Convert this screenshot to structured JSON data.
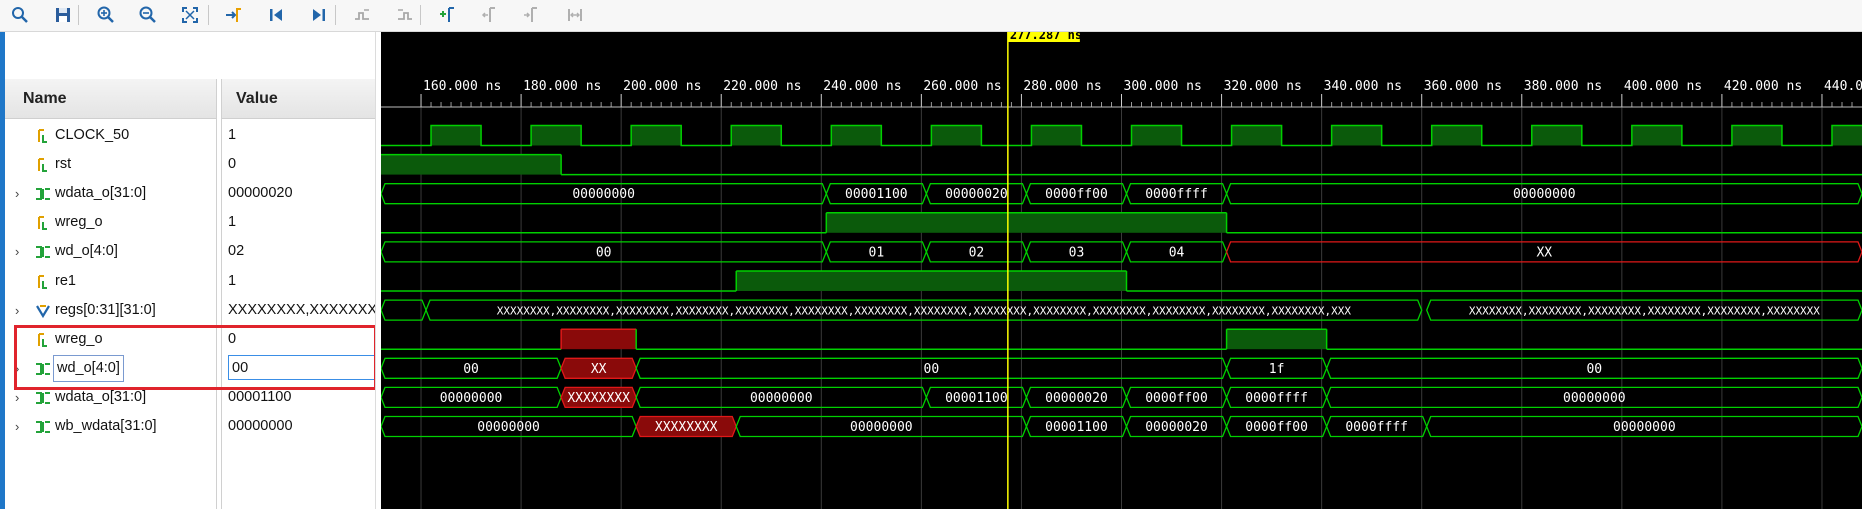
{
  "toolbar": {
    "buttons": [
      {
        "name": "search-icon"
      },
      {
        "name": "save-icon"
      },
      {
        "name": "zoom-in-icon"
      },
      {
        "name": "zoom-out-icon"
      },
      {
        "name": "zoom-fit-icon"
      },
      {
        "name": "go-to-cursor-icon"
      },
      {
        "name": "go-to-start-icon"
      },
      {
        "name": "go-to-end-icon"
      },
      {
        "name": "previous-transition-icon"
      },
      {
        "name": "next-transition-icon"
      },
      {
        "name": "add-marker-icon"
      },
      {
        "name": "previous-marker-icon"
      },
      {
        "name": "next-marker-icon"
      },
      {
        "name": "swap-cursors-icon"
      }
    ]
  },
  "columns": {
    "name": "Name",
    "value": "Value"
  },
  "signals": [
    {
      "name": "CLOCK_50",
      "value": "1",
      "expandable": false,
      "icon": "bit-signal-icon"
    },
    {
      "name": "rst",
      "value": "0",
      "expandable": false,
      "icon": "bit-signal-icon"
    },
    {
      "name": "wdata_o[31:0]",
      "value": "00000020",
      "expandable": true,
      "icon": "bus-signal-icon"
    },
    {
      "name": "wreg_o",
      "value": "1",
      "expandable": false,
      "icon": "bit-signal-icon"
    },
    {
      "name": "wd_o[4:0]",
      "value": "02",
      "expandable": true,
      "icon": "bus-signal-icon"
    },
    {
      "name": "re1",
      "value": "1",
      "expandable": false,
      "icon": "bit-signal-icon"
    },
    {
      "name": "regs[0:31][31:0]",
      "value": "XXXXXXXX,XXXXXXXX",
      "expandable": true,
      "icon": "array-signal-icon"
    },
    {
      "name": "wreg_o",
      "value": "0",
      "expandable": false,
      "icon": "bit-signal-icon"
    },
    {
      "name": "wd_o[4:0]",
      "value": "00",
      "expandable": true,
      "icon": "bus-signal-icon"
    },
    {
      "name": "wdata_o[31:0]",
      "value": "00001100",
      "expandable": true,
      "icon": "bus-signal-icon"
    },
    {
      "name": "wb_wdata[31:0]",
      "value": "00000000",
      "expandable": true,
      "icon": "bus-signal-icon"
    }
  ],
  "cursor": {
    "label": "277.287 ns",
    "time": 277.287
  },
  "timeline": {
    "start": 152,
    "end": 448,
    "ticks": [
      {
        "t": 160,
        "label": "160.000 ns"
      },
      {
        "t": 180,
        "label": "180.000 ns"
      },
      {
        "t": 200,
        "label": "200.000 ns"
      },
      {
        "t": 220,
        "label": "220.000 ns"
      },
      {
        "t": 240,
        "label": "240.000 ns"
      },
      {
        "t": 260,
        "label": "260.000 ns"
      },
      {
        "t": 280,
        "label": "280.000 ns"
      },
      {
        "t": 300,
        "label": "300.000 ns"
      },
      {
        "t": 320,
        "label": "320.000 ns"
      },
      {
        "t": 340,
        "label": "340.000 ns"
      },
      {
        "t": 360,
        "label": "360.000 ns"
      },
      {
        "t": 380,
        "label": "380.000 ns"
      },
      {
        "t": 400,
        "label": "400.000 ns"
      },
      {
        "t": 420,
        "label": "420.000 ns"
      },
      {
        "t": 440,
        "label": "440.000 ns"
      }
    ]
  },
  "waves": [
    {
      "kind": "clock",
      "period": 20,
      "high_start": 162,
      "low_start": 152
    },
    {
      "kind": "bit",
      "segments": [
        {
          "from": 152,
          "to": 188,
          "v": 1
        },
        {
          "from": 188,
          "to": 448,
          "v": 0
        }
      ]
    },
    {
      "kind": "bus",
      "segments": [
        {
          "from": 152,
          "to": 241,
          "label": "00000000"
        },
        {
          "from": 241,
          "to": 261,
          "label": "00001100"
        },
        {
          "from": 261,
          "to": 281,
          "label": "00000020"
        },
        {
          "from": 281,
          "to": 301,
          "label": "0000ff00"
        },
        {
          "from": 301,
          "to": 321,
          "label": "0000ffff"
        },
        {
          "from": 321,
          "to": 448,
          "label": "00000000"
        }
      ]
    },
    {
      "kind": "bit",
      "segments": [
        {
          "from": 152,
          "to": 241,
          "v": 0
        },
        {
          "from": 241,
          "to": 321,
          "v": 1
        },
        {
          "from": 321,
          "to": 448,
          "v": 0
        }
      ]
    },
    {
      "kind": "bus",
      "segments": [
        {
          "from": 152,
          "to": 241,
          "label": "00"
        },
        {
          "from": 241,
          "to": 261,
          "label": "01"
        },
        {
          "from": 261,
          "to": 281,
          "label": "02"
        },
        {
          "from": 281,
          "to": 301,
          "label": "03"
        },
        {
          "from": 301,
          "to": 321,
          "label": "04"
        },
        {
          "from": 321,
          "to": 448,
          "label": "XX",
          "x": true
        }
      ]
    },
    {
      "kind": "bit",
      "segments": [
        {
          "from": 152,
          "to": 223,
          "v": 0
        },
        {
          "from": 223,
          "to": 301,
          "v": 1
        },
        {
          "from": 301,
          "to": 448,
          "v": 0
        }
      ]
    },
    {
      "kind": "bus",
      "segments": [
        {
          "from": 152,
          "to": 161,
          "label": ""
        },
        {
          "from": 161,
          "to": 360,
          "label": "XXXXXXXX,XXXXXXXX,XXXXXXXX,XXXXXXXX,XXXXXXXX,XXXXXXXX,XXXXXXXX,XXXXXXXX,XXXXXXXX,XXXXXXXX,XXXXXXXX,XXXXXXXX,XXXXXXXX,XXXXXXXX,XXX",
          "x": false,
          "small": true
        },
        {
          "from": 361,
          "to": 448,
          "label": "XXXXXXXX,XXXXXXXX,XXXXXXXX,XXXXXXXX,XXXXXXXX,XXXXXXXX",
          "x": false,
          "small": true
        }
      ]
    },
    {
      "kind": "bit",
      "segments": [
        {
          "from": 152,
          "to": 188,
          "v": 0
        },
        {
          "from": 188,
          "to": 203,
          "v": 1,
          "x": true
        },
        {
          "from": 203,
          "to": 321,
          "v": 0
        },
        {
          "from": 321,
          "to": 341,
          "v": 1
        },
        {
          "from": 341,
          "to": 448,
          "v": 0
        }
      ]
    },
    {
      "kind": "bus",
      "segments": [
        {
          "from": 152,
          "to": 188,
          "label": "00"
        },
        {
          "from": 188,
          "to": 203,
          "label": "XX",
          "x": true
        },
        {
          "from": 203,
          "to": 321,
          "label": "00"
        },
        {
          "from": 321,
          "to": 341,
          "label": "1f"
        },
        {
          "from": 341,
          "to": 448,
          "label": "00"
        }
      ]
    },
    {
      "kind": "bus",
      "segments": [
        {
          "from": 152,
          "to": 188,
          "label": "00000000"
        },
        {
          "from": 188,
          "to": 203,
          "label": "XXXXXXXX",
          "x": true
        },
        {
          "from": 203,
          "to": 261,
          "label": "00000000"
        },
        {
          "from": 261,
          "to": 281,
          "label": "00001100"
        },
        {
          "from": 281,
          "to": 301,
          "label": "00000020"
        },
        {
          "from": 301,
          "to": 321,
          "label": "0000ff00"
        },
        {
          "from": 321,
          "to": 341,
          "label": "0000ffff"
        },
        {
          "from": 341,
          "to": 448,
          "label": "00000000"
        }
      ]
    },
    {
      "kind": "bus",
      "segments": [
        {
          "from": 152,
          "to": 203,
          "label": "00000000"
        },
        {
          "from": 203,
          "to": 223,
          "label": "XXXXXXXX",
          "x": true
        },
        {
          "from": 223,
          "to": 281,
          "label": "00000000"
        },
        {
          "from": 281,
          "to": 301,
          "label": "00001100"
        },
        {
          "from": 301,
          "to": 321,
          "label": "00000020"
        },
        {
          "from": 321,
          "to": 341,
          "label": "0000ff00"
        },
        {
          "from": 341,
          "to": 361,
          "label": "0000ffff"
        },
        {
          "from": 361,
          "to": 448,
          "label": "00000000"
        }
      ]
    }
  ],
  "colors": {
    "wave": "#00d000",
    "fill": "#0b5a0b",
    "xwave": "#e01818",
    "xfill": "#8a0a0a",
    "cursor": "#ffff00",
    "cursor_label_bg": "#ffff00",
    "highlight": "#e0242c"
  }
}
